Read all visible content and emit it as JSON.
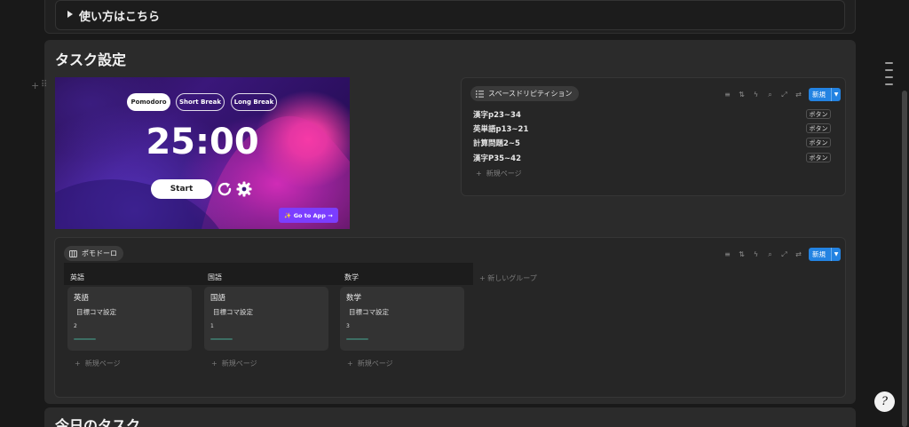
{
  "toggle": {
    "label": "使い方はこちら"
  },
  "section": {
    "title": "タスク設定"
  },
  "pomodoro": {
    "tabs": [
      {
        "label": "Pomodoro",
        "active": true
      },
      {
        "label": "Short Break",
        "active": false
      },
      {
        "label": "Long Break",
        "active": false
      }
    ],
    "time": "25:00",
    "start_label": "Start",
    "go_to_app_label": "✨ Go to App →",
    "accent_color": "#7b3dff"
  },
  "spaced_list": {
    "view_name": "スペースドリピティション",
    "new_label": "新規",
    "rows": [
      {
        "title": "漢字p23~34",
        "button": "ボタン"
      },
      {
        "title": "英単語p13~21",
        "button": "ボタン"
      },
      {
        "title": "計算問題2~5",
        "button": "ボタン"
      },
      {
        "title": "漢字P35~42",
        "button": "ボタン"
      }
    ],
    "new_page_label": "新規ページ"
  },
  "board": {
    "view_name": "ポモドーロ",
    "new_label": "新規",
    "groups": [
      {
        "name": "英語",
        "card_title": "英語",
        "property": "目標コマ設定",
        "value": "2",
        "new_page_label": "新規ページ"
      },
      {
        "name": "国語",
        "card_title": "国語",
        "property": "目標コマ設定",
        "value": "1",
        "new_page_label": "新規ページ"
      },
      {
        "name": "数学",
        "card_title": "数学",
        "property": "目標コマ設定",
        "value": "3",
        "new_page_label": "新規ページ"
      }
    ],
    "new_group_label": "新しいグループ"
  },
  "next_section": {
    "title": "今日のタスク"
  },
  "help": {
    "label": "?"
  },
  "colors": {
    "primary_button": "#2383e2",
    "background": "#191919",
    "panel": "#2b2b2b"
  }
}
